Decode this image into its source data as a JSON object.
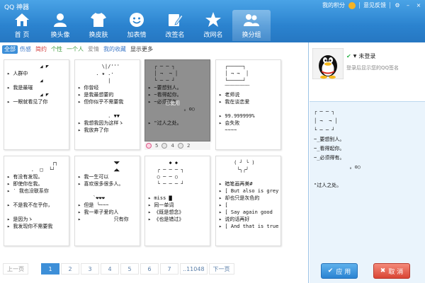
{
  "app": {
    "title": "QQ 神器"
  },
  "top_right": {
    "points": "我的积分",
    "feedback": "意见反馈"
  },
  "nav": [
    {
      "label": "首 页",
      "icon": "home-icon"
    },
    {
      "label": "换头像",
      "icon": "avatar-icon"
    },
    {
      "label": "换皮肤",
      "icon": "shirt-icon"
    },
    {
      "label": "加表情",
      "icon": "smiley-icon"
    },
    {
      "label": "改签名",
      "icon": "pencil-icon"
    },
    {
      "label": "改网名",
      "icon": "star-icon"
    },
    {
      "label": "换分组",
      "icon": "group-icon"
    }
  ],
  "categories": [
    {
      "label": "全部",
      "color": "#ffffff"
    },
    {
      "label": "伤感",
      "color": "#3c78c8"
    },
    {
      "label": "简约",
      "color": "#d23c3c"
    },
    {
      "label": "个性",
      "color": "#3a9a3a"
    },
    {
      "label": "一个人",
      "color": "#3a9a3a"
    },
    {
      "label": "爱情",
      "color": "#8a8a8a"
    },
    {
      "label": "我的收藏",
      "color": "#3c78c8"
    },
    {
      "label": "显示更多",
      "color": "#333333"
    }
  ],
  "cards": [
    {
      "text": "           ◢ ◤\n▸ 人群中\n           ◢\n▸ 我是最璀\n           ◢ ◤\n▸ 一眼就看见了你\n\n\n\n\n\n"
    },
    {
      "text": "        \\|/'''\n      . ★ .·\n          |\n▸ 你曾经\n▸ 是我最想要的\n▸ 但你似乎不需要我\n\n          . ▼▼\n▸ 我想我因为这样ゝ\n▸ 我放弃了你\n"
    },
    {
      "text": "  ┌ ─ ─ ┐\n  │ ¬  ¬ │\n  └ ─ ─ ┘\n▸ ~要想别人。\n▸ ~看得起你。\n▸ ~必须得有。\n            。o○\n\n▸ \"过人之处。\n"
    },
    {
      "text": "  ┌─────┐\n  │ ¬ ¬  │\n  └─────┘\n  ﹋﹋﹋﹋﹋\n▸ 老师说\n▸ 我在谈恋爱\n\n▸ 99.999999%\n▸ 会失败\n  ~~~~\n"
    },
    {
      "text": "               ┌┐\n        .  □  └┘\n▸ 有没有发现。\n▸ 即使你在我。\n▸ ‵ 我也没联系你\n\n▸ 不是我不在乎你，\n\n▸ 是因为ゝ\n▸ 我发现你不需要我\n"
    },
    {
      "text": "            ◥◤\n            ◢◣\n▸ 我一生可以\n▸ 喜欢很多很多人。\n\n     `❤❤❤\n▸ 但是 ╰~~~\n▸ 我一辈子爱的人\n▸           只有你\n"
    },
    {
      "text": "       ◆ ◆\n   ┌ ─ ─ ─ ┐\n   ○ ─ ─ ○\n   └ ─ ─ ─ ┘\n\n▸ miss ▇\n▸ 同一单词\n▸ 《既是想念》\n▸ 《也是错过》\n"
    },
    {
      "text": "     ( ╯ ╰ )\n      ╰╮╭╯\n\n▸ 暗笔画再美#\n▸ [ But also is grey\n▸ 却也只是灰色的\n▸ [\n▸ [ Say again good\n▸ 说的话再好\n▸ [ And that is true\n"
    }
  ],
  "selected_card": {
    "label": "已使用",
    "likes": "5",
    "dislikes": "4",
    "comments": "2"
  },
  "pager": {
    "prev": "上一页",
    "pages": [
      "1",
      "2",
      "3",
      "4",
      "5",
      "6",
      "7",
      "..11048"
    ],
    "next": "下一页",
    "current": "1"
  },
  "user": {
    "status": "未登录",
    "hint": "登录后显示您的QQ签名"
  },
  "preview": {
    "text": "┌ ─ ─ ┐\n│ ¬  ¬ │\n└ ─ ─ ┘\n~_要想别人。\n~_看得起你。\n~_必须得有。\n            。o○\n\n\"过人之处。"
  },
  "buttons": {
    "apply": "应 用",
    "cancel": "取 消"
  }
}
